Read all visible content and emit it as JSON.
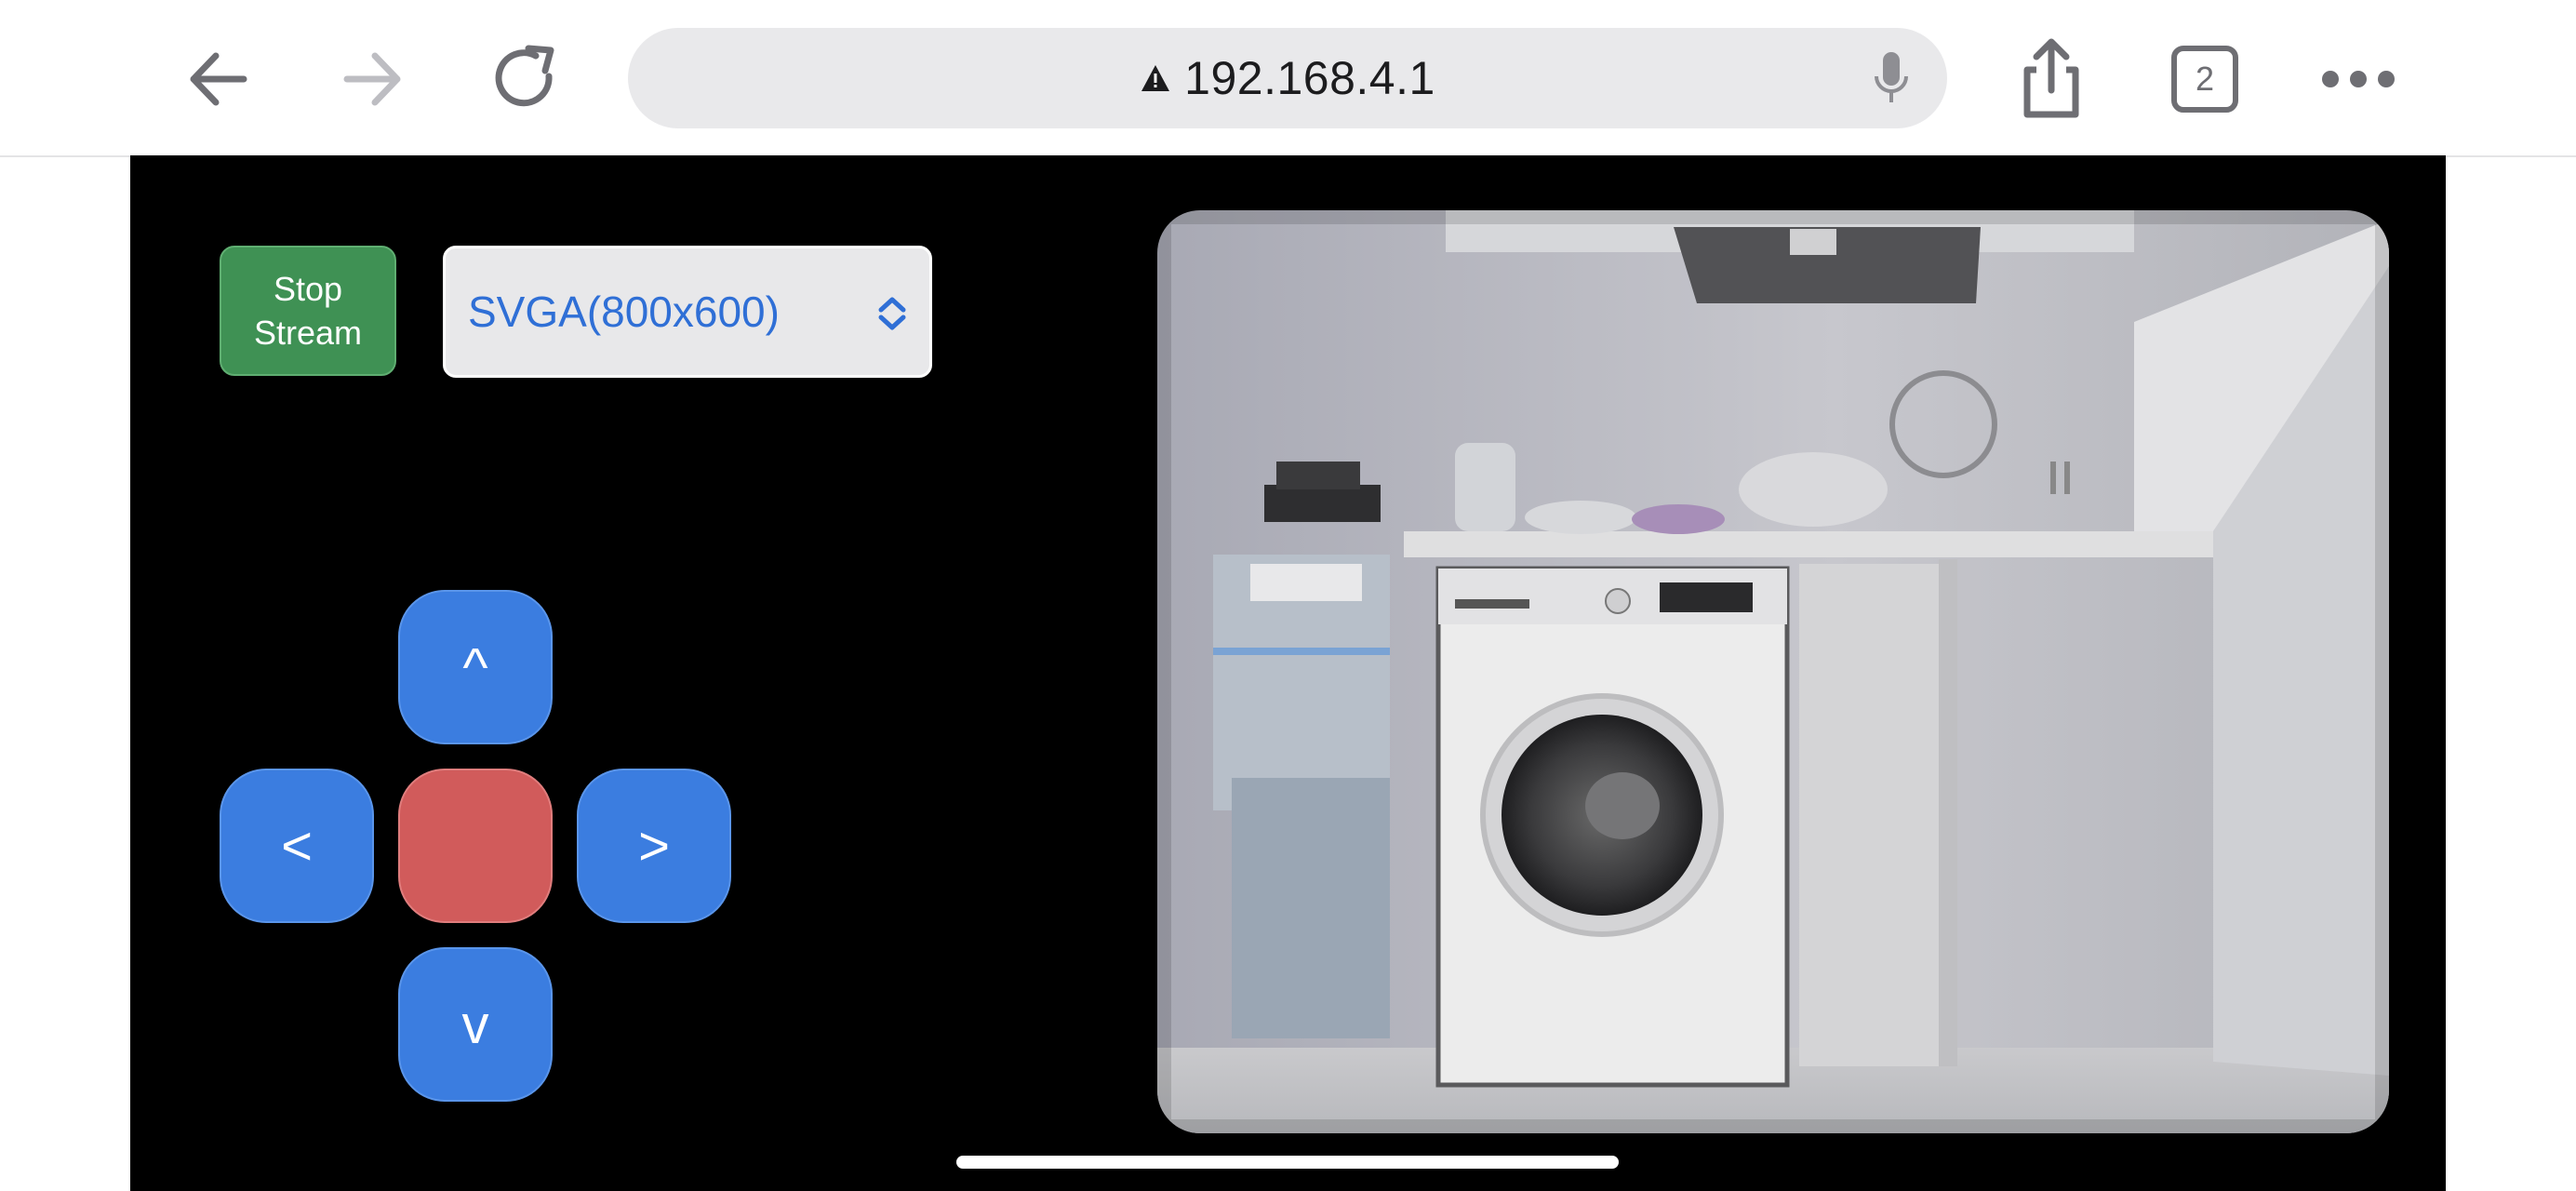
{
  "browser": {
    "url": "192.168.4.1",
    "tab_count": "2",
    "icons": {
      "back": "back-arrow-icon",
      "forward": "forward-arrow-icon",
      "reload": "reload-icon",
      "warning": "warning-triangle-icon",
      "mic": "microphone-icon",
      "share": "share-icon",
      "tabs": "tabs-icon",
      "more": "more-dots-icon"
    }
  },
  "controls": {
    "stop_stream_line1": "Stop",
    "stop_stream_line2": "Stream",
    "resolution_selected": "SVGA(800x600)",
    "dpad": {
      "up": "^",
      "left": "<",
      "center": "",
      "right": ">",
      "down": "v"
    }
  },
  "colors": {
    "page_background": "#000000",
    "stop_stream_button": "#3f9154",
    "dpad_button": "#3b7de0",
    "dpad_center": "#d15b5b",
    "select_text": "#2f6fd6"
  }
}
